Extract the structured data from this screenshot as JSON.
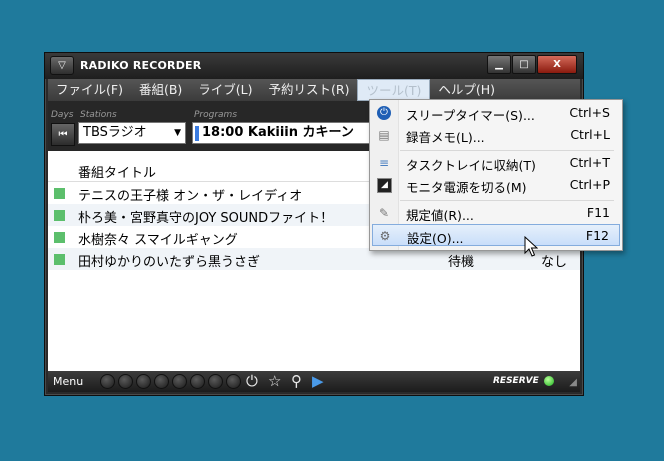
{
  "window": {
    "title": "RADIKO RECORDER",
    "controls": {
      "minimize": "▁",
      "maximize": "□",
      "close": "X"
    }
  },
  "menubar": [
    "ファイル(F)",
    "番組(B)",
    "ライブ(L)",
    "予約リスト(R)",
    "ツール(T)",
    "ヘルプ(H)"
  ],
  "controls": {
    "days_label": "Days",
    "stations_label": "Stations",
    "programs_label": "Programs",
    "station_value": "TBSラジオ",
    "program_value": "18:00  Kakiiin カキーン"
  },
  "table": {
    "header": "番組タイトル",
    "rows": [
      {
        "title": "テニスの王子様 オン・ザ・レイディオ",
        "status": "",
        "kind": ""
      },
      {
        "title": "朴ろ美・宮野真守のJOY SOUNDファイト！",
        "status": "",
        "kind": ""
      },
      {
        "title": "水樹奈々 スマイルギャング",
        "status": "",
        "kind": ""
      },
      {
        "title": "田村ゆかりのいたずら黒うさぎ",
        "status": "待機",
        "kind": "なし"
      }
    ]
  },
  "tools_menu": {
    "items": [
      {
        "label": "スリープタイマー(S)...",
        "shortcut": "Ctrl+S",
        "icon": "power-icon"
      },
      {
        "label": "録音メモ(L)...",
        "shortcut": "Ctrl+L",
        "icon": "memo-icon"
      },
      {
        "label": "タスクトレイに収納(T)",
        "shortcut": "Ctrl+T",
        "icon": "tray-icon"
      },
      {
        "label": "モニタ電源を切る(M)",
        "shortcut": "Ctrl+P",
        "icon": "monitor-icon"
      },
      {
        "label": "規定値(R)...",
        "shortcut": "F11",
        "icon": "defaults-icon"
      },
      {
        "label": "設定(O)...",
        "shortcut": "F12",
        "icon": "settings-icon"
      }
    ]
  },
  "bottom": {
    "menu_label": "Menu",
    "reserve_label": "RESERVE"
  },
  "colors": {
    "desktop": "#1f7a9c",
    "status_square": "#5cbf6c",
    "reserve_led": "#19b21b",
    "highlight": "#c9defa"
  }
}
